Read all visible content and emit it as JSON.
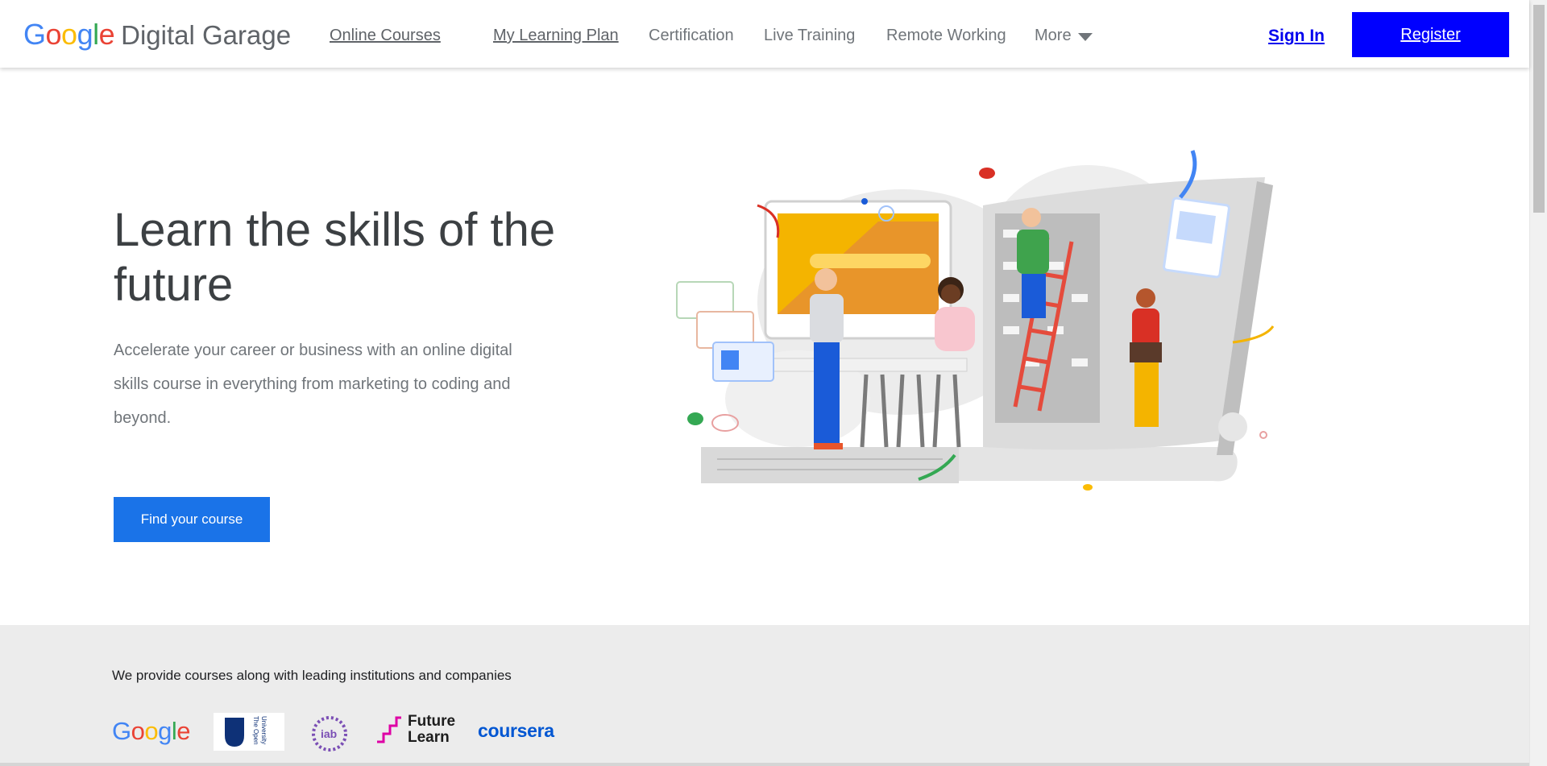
{
  "header": {
    "logo_google": [
      "G",
      "o",
      "o",
      "g",
      "l",
      "e"
    ],
    "logo_product": "Digital Garage",
    "nav": {
      "online_courses": "Online Courses",
      "my_learning_plan": "My Learning Plan",
      "certification": "Certification",
      "live_training": "Live Training",
      "remote_working": "Remote Working",
      "more": "More"
    },
    "sign_in": "Sign In",
    "register": "Register"
  },
  "hero": {
    "title": "Learn the skills of the future",
    "description": "Accelerate your career or business with an online digital skills course in everything from marketing to coding and beyond.",
    "cta": "Find your course"
  },
  "partners": {
    "intro": "We provide courses along with leading institutions and companies",
    "google": [
      "G",
      "o",
      "o",
      "g",
      "l",
      "e"
    ],
    "open_university": "The Open University",
    "iab": "iab",
    "future_learn_line1": "Future",
    "future_learn_line2": "Learn",
    "coursera": "coursera"
  },
  "colors": {
    "register_bg": "#0000ff",
    "cta_bg": "#1a73e8",
    "partners_bg": "#ececec",
    "link": "#0000ee"
  }
}
